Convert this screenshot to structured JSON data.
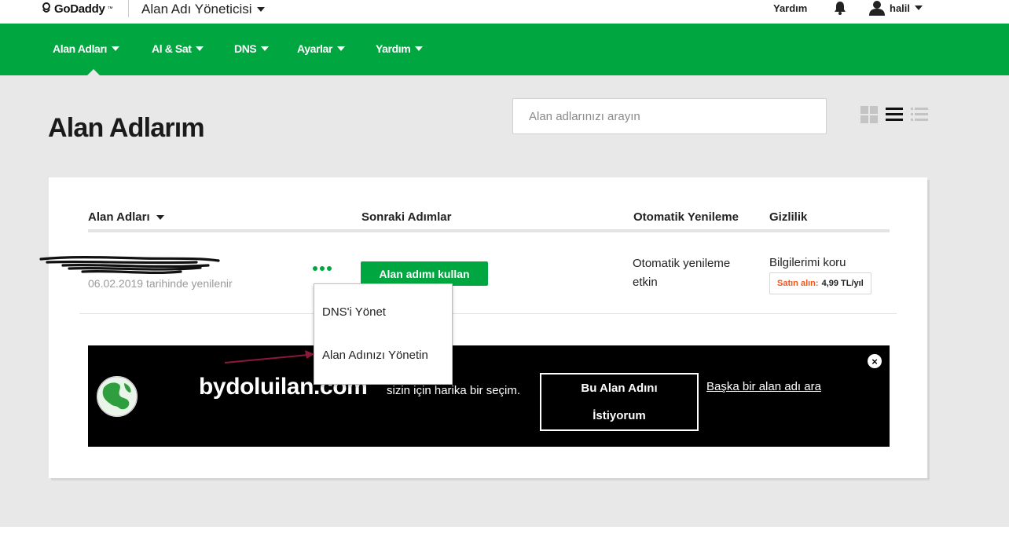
{
  "topbar": {
    "logo_text": "GoDaddy",
    "logo_tm": "™",
    "app_title": "Alan Adı Yöneticisi",
    "help": "Yardım",
    "bell_icon": "bell-icon",
    "user_name": "halil",
    "user_icon": "user-icon"
  },
  "nav": {
    "items": [
      {
        "label": "Alan Adları"
      },
      {
        "label": "Al & Sat"
      },
      {
        "label": "DNS"
      },
      {
        "label": "Ayarlar"
      },
      {
        "label": "Yardım"
      }
    ],
    "active": "Alan Adları"
  },
  "page": {
    "title": "Alan Adlarım",
    "search_placeholder": "Alan adlarınızı arayın",
    "view_icons": [
      "grid-view-icon",
      "list-view-icon",
      "compact-list-view-icon"
    ]
  },
  "table": {
    "columns": {
      "domains": "Alan Adları",
      "next_steps": "Sonraki Adımlar",
      "auto_renew": "Otomatik Yenileme",
      "privacy": "Gizlilik"
    },
    "row": {
      "renew_date": "06.02.2019 tarihinde yenilenir",
      "use_button": "Alan adımı kullan",
      "auto_renew_status": "Otomatik yenileme etkin",
      "privacy_label": "Bilgilerimi koru",
      "buy_label": "Satın alın:",
      "buy_price": "4,99  TL/yıl"
    }
  },
  "dropdown": {
    "items": [
      {
        "label": "DNS'i Yönet"
      },
      {
        "label": "Alan Adınızı Yönetin"
      }
    ]
  },
  "promo": {
    "domain": "bydoluilan.com",
    "text": "sizin için harika bir seçim.",
    "button_line1": "Bu Alan Adını",
    "button_line2": "İstiyorum",
    "link": "Başka bir alan adı ara",
    "close_symbol": "×"
  },
  "colors": {
    "brand_green": "#00a63f",
    "background_gray": "#e8e8e8",
    "promo_black": "#000000",
    "buy_orange": "#f0551a",
    "annotation_arrow": "#8b1a3a"
  }
}
